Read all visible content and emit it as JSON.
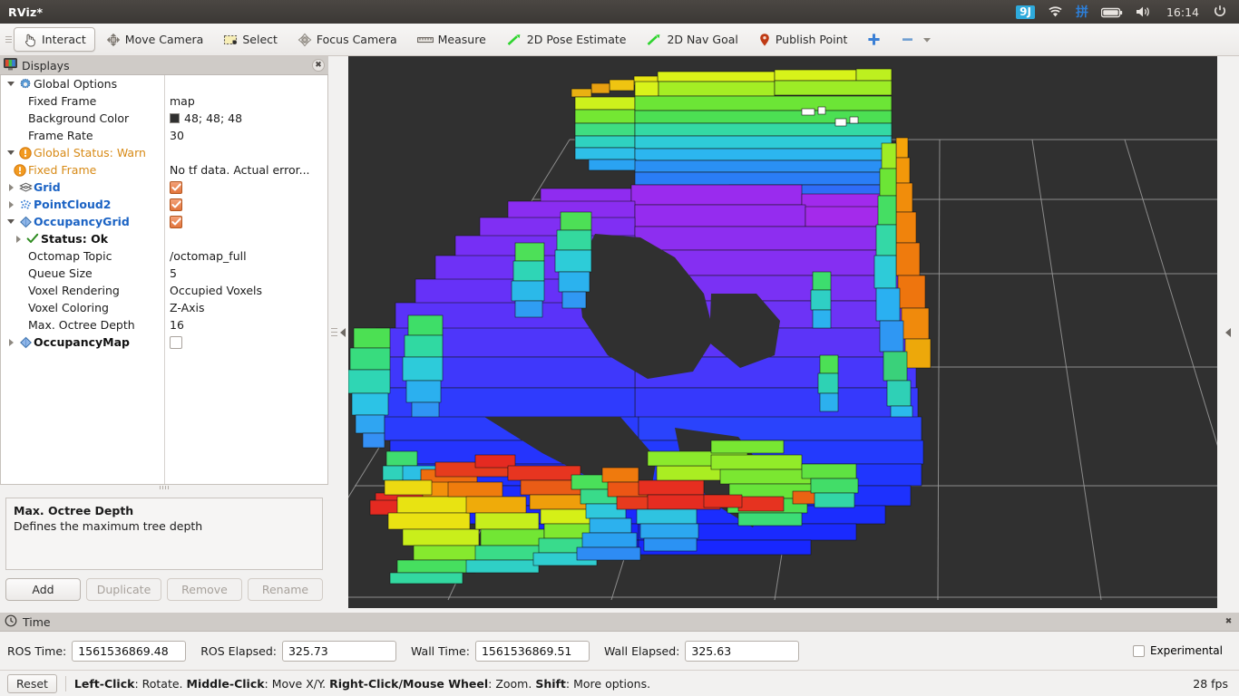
{
  "window": {
    "title": "RViz*"
  },
  "tray": {
    "ime_icon": "ime-icon",
    "ime_glyph": "9J",
    "wifi_icon": "wifi-icon",
    "pinyin_icon": "pinyin-icon",
    "pinyin_glyph": "拼",
    "battery_icon": "battery-icon",
    "volume_icon": "volume-icon",
    "clock": "16:14",
    "power_icon": "power-gear-icon"
  },
  "toolbar": {
    "items": [
      {
        "label": "Interact",
        "icon": "hand-cursor-icon",
        "active": true
      },
      {
        "label": "Move Camera",
        "icon": "move-camera-icon",
        "active": false
      },
      {
        "label": "Select",
        "icon": "select-rectangle-icon",
        "active": false
      },
      {
        "label": "Focus Camera",
        "icon": "focus-camera-icon",
        "active": false
      },
      {
        "label": "Measure",
        "icon": "ruler-icon",
        "active": false
      },
      {
        "label": "2D Pose Estimate",
        "icon": "pose-arrow-icon",
        "active": false
      },
      {
        "label": "2D Nav Goal",
        "icon": "nav-goal-arrow-icon",
        "active": false
      },
      {
        "label": "Publish Point",
        "icon": "map-pin-icon",
        "active": false
      }
    ],
    "add_tool_icon": "plus-icon",
    "remove_tool_icon": "minus-icon",
    "overflow_icon": "chevron-down-icon"
  },
  "displays": {
    "title": "Displays",
    "close_icon": "close-icon",
    "rows": [
      {
        "name": "Global Options",
        "value": "",
        "icon": "gear-icon",
        "arrow": "down",
        "indent": 0,
        "style": "plain"
      },
      {
        "name": "Fixed Frame",
        "value": "map",
        "icon": "",
        "arrow": "",
        "indent": 30,
        "style": "plain"
      },
      {
        "name": "Background Color",
        "value": "48; 48; 48",
        "icon": "",
        "arrow": "",
        "indent": 30,
        "style": "plain",
        "swatch": "#303030"
      },
      {
        "name": "Frame Rate",
        "value": "30",
        "icon": "",
        "arrow": "",
        "indent": 30,
        "style": "plain"
      },
      {
        "name": "Global Status: Warn",
        "value": "",
        "icon": "warning-icon",
        "arrow": "down",
        "indent": 0,
        "style": "warn"
      },
      {
        "name": "Fixed Frame",
        "value": "No tf data.  Actual error...",
        "icon": "warning-icon",
        "arrow": "",
        "indent": 24,
        "style": "warn"
      },
      {
        "name": "Grid",
        "value": "",
        "icon": "grid-icon",
        "arrow": "right",
        "indent": 0,
        "style": "blue",
        "checkbox": "on"
      },
      {
        "name": "PointCloud2",
        "value": "",
        "icon": "pointcloud-icon",
        "arrow": "right",
        "indent": 0,
        "style": "blue",
        "checkbox": "on"
      },
      {
        "name": "OccupancyGrid",
        "value": "",
        "icon": "diamond-icon",
        "arrow": "down",
        "indent": 0,
        "style": "blue",
        "checkbox": "on"
      },
      {
        "name": "Status: Ok",
        "value": "",
        "icon": "check-icon",
        "arrow": "right",
        "indent": 18,
        "style": "boldblk"
      },
      {
        "name": "Octomap Topic",
        "value": "/octomap_full",
        "icon": "",
        "arrow": "",
        "indent": 30,
        "style": "plain"
      },
      {
        "name": "Queue Size",
        "value": "5",
        "icon": "",
        "arrow": "",
        "indent": 30,
        "style": "plain"
      },
      {
        "name": "Voxel Rendering",
        "value": "Occupied Voxels",
        "icon": "",
        "arrow": "",
        "indent": 30,
        "style": "plain"
      },
      {
        "name": "Voxel Coloring",
        "value": "Z-Axis",
        "icon": "",
        "arrow": "",
        "indent": 30,
        "style": "plain"
      },
      {
        "name": "Max. Octree Depth",
        "value": "16",
        "icon": "",
        "arrow": "",
        "indent": 30,
        "style": "plain"
      },
      {
        "name": "OccupancyMap",
        "value": "",
        "icon": "diamond-icon",
        "arrow": "right",
        "indent": 0,
        "style": "boldblk",
        "checkbox": "off"
      }
    ],
    "description": {
      "title": "Max. Octree Depth",
      "text": "Defines the maximum tree depth"
    },
    "buttons": [
      {
        "label": "Add",
        "enabled": true
      },
      {
        "label": "Duplicate",
        "enabled": false
      },
      {
        "label": "Remove",
        "enabled": false
      },
      {
        "label": "Rename",
        "enabled": false
      }
    ]
  },
  "view3d": {
    "background_color": "#303030",
    "grid_color": "#a0a0a0",
    "display_type": "octomap-occupancy-voxels",
    "voxel_coloring": "Z-Axis rainbow"
  },
  "time_panel": {
    "title": "Time",
    "close_icon": "close-icon",
    "fields": [
      {
        "label": "ROS Time:",
        "value": "1561536869.48"
      },
      {
        "label": "ROS Elapsed:",
        "value": "325.73"
      },
      {
        "label": "Wall Time:",
        "value": "1561536869.51"
      },
      {
        "label": "Wall Elapsed:",
        "value": "325.63"
      }
    ],
    "experimental_label": "Experimental",
    "experimental_checked": false
  },
  "statusbar": {
    "reset_label": "Reset",
    "hint_parts": [
      {
        "text": "Left-Click",
        "bold": true
      },
      {
        "text": ": Rotate.  ",
        "bold": false
      },
      {
        "text": "Middle-Click",
        "bold": true
      },
      {
        "text": ": Move X/Y.  ",
        "bold": false
      },
      {
        "text": "Right-Click/Mouse Wheel",
        "bold": true
      },
      {
        "text": ": Zoom.  ",
        "bold": false
      },
      {
        "text": "Shift",
        "bold": true
      },
      {
        "text": ": More options.",
        "bold": false
      }
    ],
    "fps": "28 fps"
  }
}
